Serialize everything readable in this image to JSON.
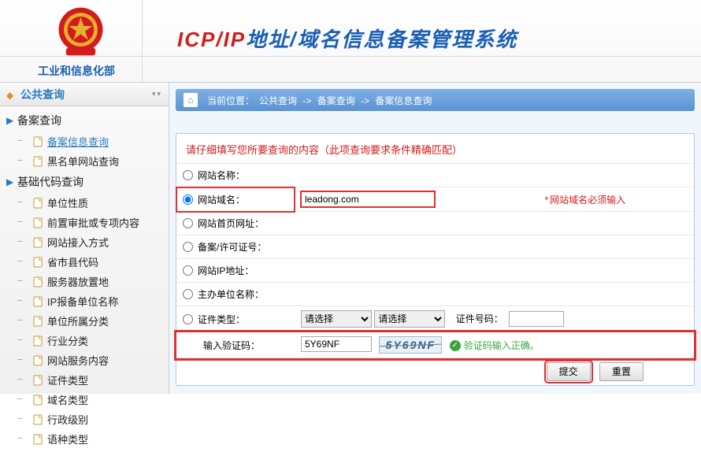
{
  "header": {
    "ministry": "工业和信息化部",
    "title_red": "ICP/IP",
    "title_blue": "地址/域名信息备案管理系统"
  },
  "sidebar": {
    "section_title": "公共查询",
    "groups": [
      {
        "label": "备案查询",
        "items": [
          {
            "label": "备案信息查询",
            "selected": true
          },
          {
            "label": "黑名单网站查询",
            "selected": false
          }
        ]
      },
      {
        "label": "基础代码查询",
        "items": [
          {
            "label": "单位性质"
          },
          {
            "label": "前置审批或专项内容"
          },
          {
            "label": "网站接入方式"
          },
          {
            "label": "省市县代码"
          },
          {
            "label": "服务器放置地"
          },
          {
            "label": "IP报备单位名称"
          },
          {
            "label": "单位所属分类"
          },
          {
            "label": "行业分类"
          },
          {
            "label": "网站服务内容"
          },
          {
            "label": "证件类型"
          },
          {
            "label": "域名类型"
          },
          {
            "label": "行政级别"
          },
          {
            "label": "语种类型"
          }
        ]
      }
    ]
  },
  "breadcrumb": {
    "prefix": "当前位置：",
    "items": [
      "公共查询",
      "备案查询",
      "备案信息查询"
    ],
    "sep": "->"
  },
  "form": {
    "instruction": "请仔细填写您所要查询的内容（此项查询要求条件精确匹配）",
    "rows": {
      "site_name": "网站名称：",
      "site_domain": "网站域名：",
      "site_domain_hint": "网站域名必须输入",
      "site_homepage": "网站首页网址：",
      "record_license": "备案/许可证号：",
      "site_ip": "网站IP地址：",
      "sponsor": "主办单位名称：",
      "cert_type": "证件类型：",
      "cert_select_placeholder": "请选择",
      "cert_no_label": "证件号码：",
      "captcha_label": "输入验证码：",
      "captcha_ok": "验证码输入正确。"
    },
    "values": {
      "site_domain": "leadong.com",
      "captcha": "5Y69NF",
      "captcha_image_text": "5Y69NF"
    },
    "buttons": {
      "submit": "提交",
      "reset": "重置"
    }
  }
}
